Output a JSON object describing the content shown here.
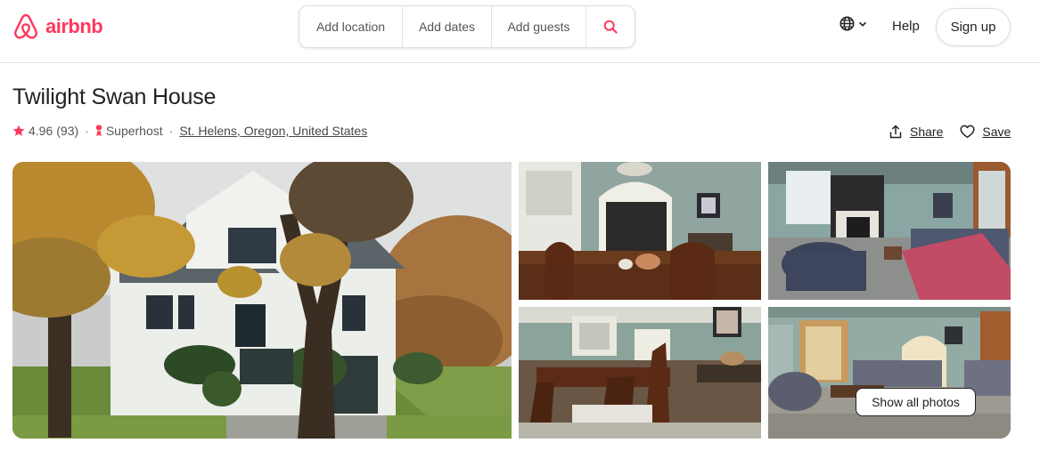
{
  "header": {
    "logo_text": "airbnb",
    "brand_color": "#ff385c",
    "search": {
      "location": "Add location",
      "dates": "Add dates",
      "guests": "Add guests",
      "search_icon": "search-icon"
    },
    "language_icon": "globe-icon",
    "help": "Help",
    "signup": "Sign up"
  },
  "listing": {
    "title": "Twilight Swan House",
    "rating": "4.96",
    "reviews": "(93)",
    "superhost": "Superhost",
    "location": "St. Helens, Oregon, United States",
    "share": "Share",
    "save": "Save"
  },
  "gallery": {
    "show_all": "Show all photos"
  }
}
